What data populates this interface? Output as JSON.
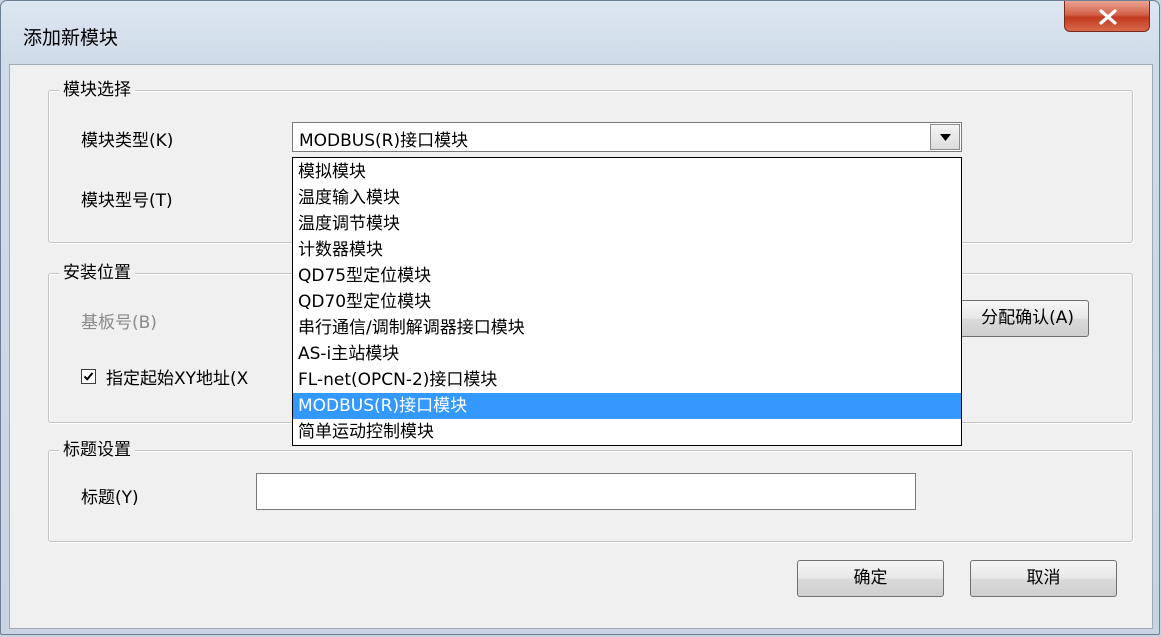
{
  "window": {
    "title": "添加新模块",
    "close_icon": "close-x-icon"
  },
  "module_select": {
    "legend": "模块选择",
    "type_label": "模块类型(K)",
    "type_value": "MODBUS(R)接口模块",
    "model_label": "模块型号(T)",
    "dropdown_options": [
      "模拟模块",
      "温度输入模块",
      "温度调节模块",
      "计数器模块",
      "QD75型定位模块",
      "QD70型定位模块",
      "串行通信/调制解调器接口模块",
      "AS-i主站模块",
      "FL-net(OPCN-2)接口模块",
      "MODBUS(R)接口模块",
      "简单运动控制模块"
    ],
    "selected_index": 9
  },
  "install_position": {
    "legend": "安装位置",
    "base_label": "基板号(B)",
    "confirm_button": "分配确认(A)",
    "xy_checkbox_label": "指定起始XY地址(X",
    "xy_checked": true
  },
  "title_setting": {
    "legend": "标题设置",
    "title_label": "标题(Y)",
    "title_value": ""
  },
  "buttons": {
    "ok": "确定",
    "cancel": "取消"
  },
  "colors": {
    "selection": "#3399ff",
    "close_button": "#c2391f"
  }
}
